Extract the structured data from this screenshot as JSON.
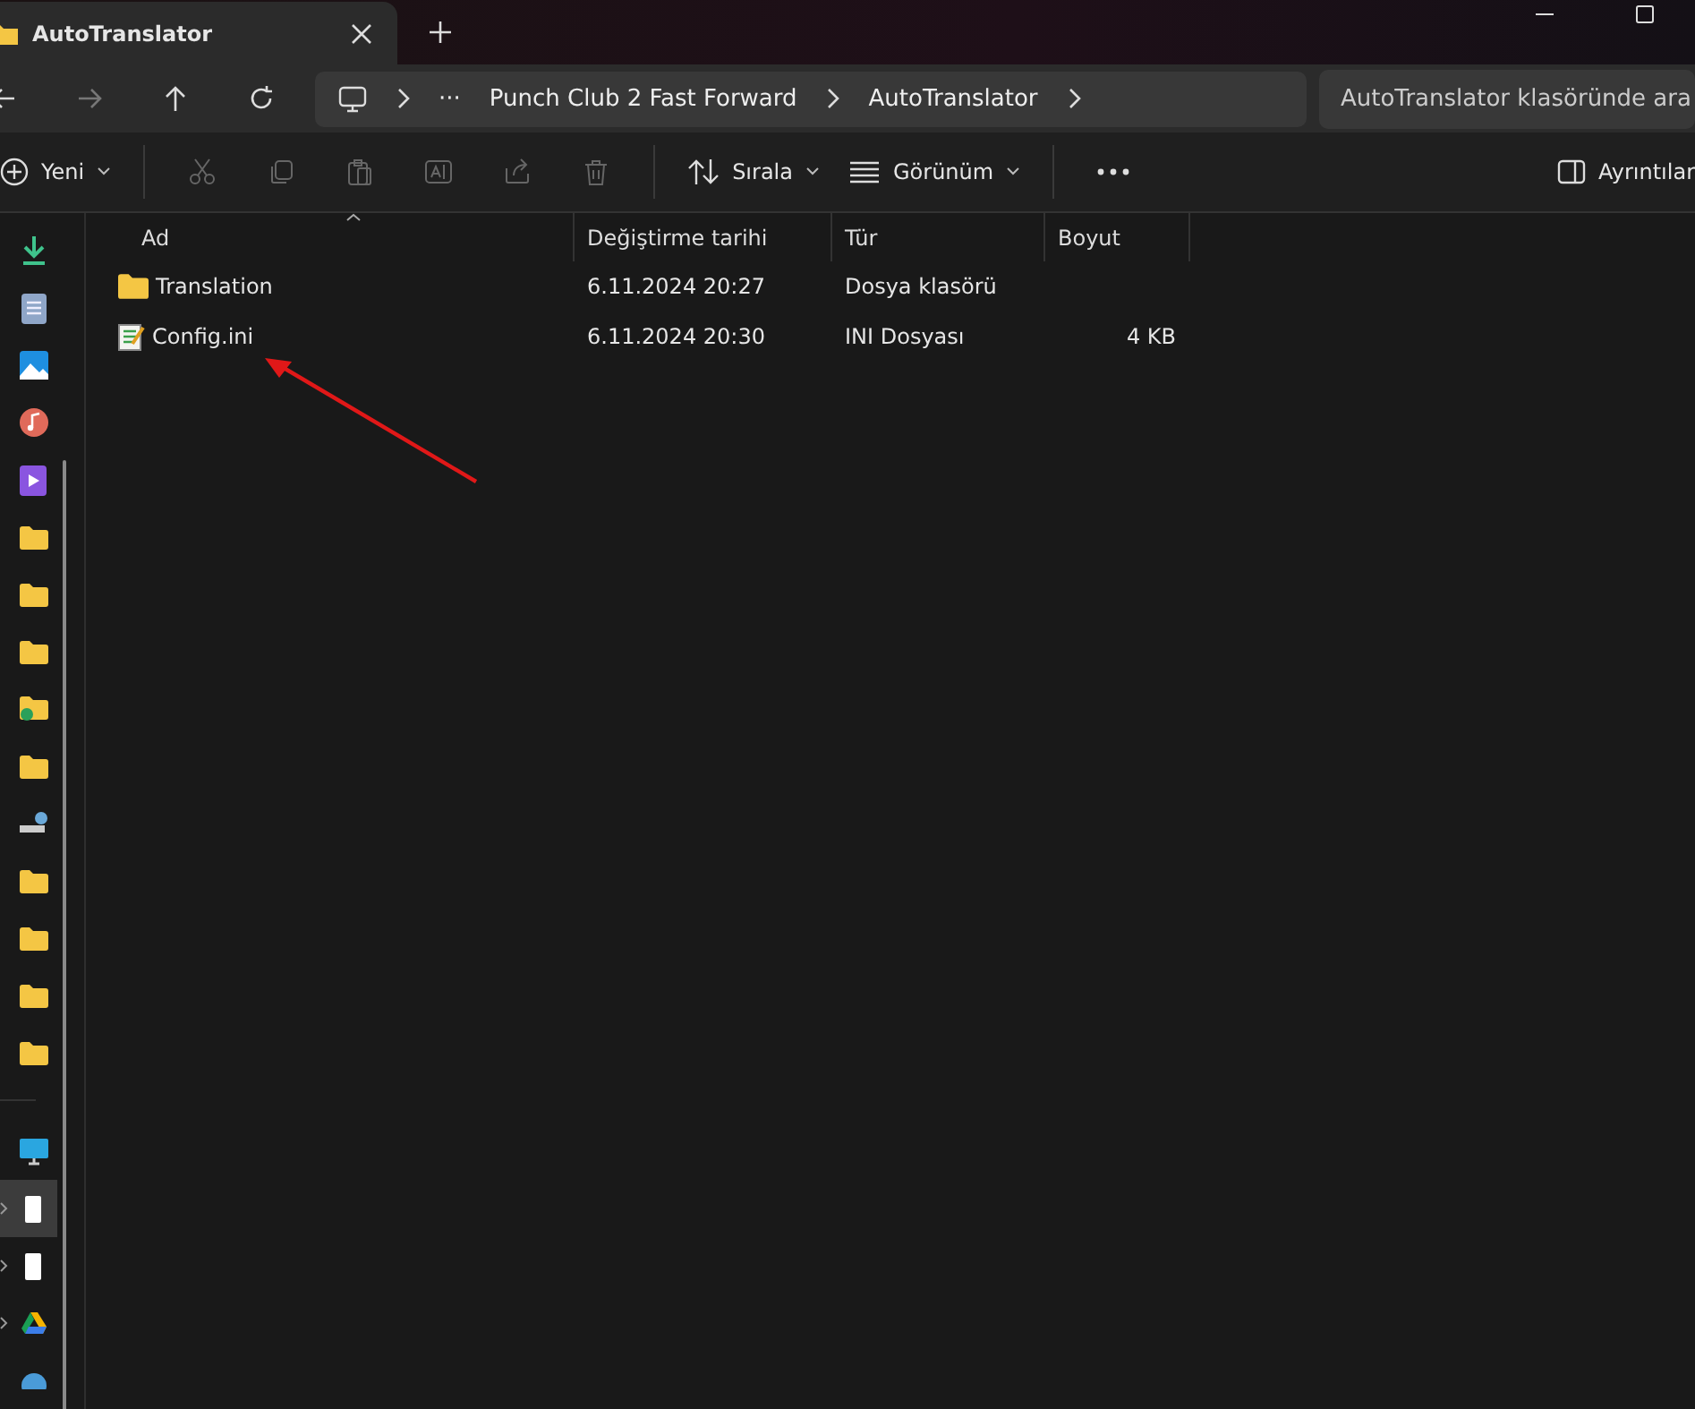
{
  "tab": {
    "title": "AutoTranslator"
  },
  "breadcrumb": {
    "ellipsis": "···",
    "segments": [
      "Punch Club 2 Fast Forward",
      "AutoTranslator"
    ]
  },
  "search": {
    "placeholder": "AutoTranslator klasöründe ara"
  },
  "toolbar": {
    "new": "Yeni",
    "sort": "Sırala",
    "view": "Görünüm",
    "details": "Ayrıntılar"
  },
  "sidebar": {
    "quick_access": [
      {
        "kind": "download",
        "selected": false,
        "expandable": false
      },
      {
        "kind": "document",
        "selected": false,
        "expandable": false
      },
      {
        "kind": "image",
        "selected": false,
        "expandable": false
      },
      {
        "kind": "music",
        "selected": false,
        "expandable": false
      },
      {
        "kind": "video",
        "selected": false,
        "expandable": false
      },
      {
        "kind": "folder",
        "selected": false,
        "expandable": false
      },
      {
        "kind": "folder",
        "selected": false,
        "expandable": false
      },
      {
        "kind": "folder",
        "selected": false,
        "expandable": false
      },
      {
        "kind": "folder-sync",
        "selected": false,
        "expandable": false
      },
      {
        "kind": "folder",
        "selected": false,
        "expandable": false
      },
      {
        "kind": "drive",
        "selected": false,
        "expandable": false
      },
      {
        "kind": "folder",
        "selected": false,
        "expandable": false
      },
      {
        "kind": "folder",
        "selected": false,
        "expandable": false
      },
      {
        "kind": "folder",
        "selected": false,
        "expandable": false
      },
      {
        "kind": "folder",
        "selected": false,
        "expandable": false
      }
    ],
    "devices": [
      {
        "kind": "computer",
        "selected": false,
        "expandable": false
      },
      {
        "kind": "page",
        "selected": true,
        "expandable": true
      },
      {
        "kind": "page",
        "selected": false,
        "expandable": true
      },
      {
        "kind": "cloud",
        "selected": false,
        "expandable": true
      },
      {
        "kind": "network",
        "selected": false,
        "expandable": false
      }
    ]
  },
  "table": {
    "columns": [
      "Ad",
      "Değiştirme tarihi",
      "Tür",
      "Boyut"
    ],
    "rows": [
      {
        "kind": "folder",
        "name": "Translation",
        "date": "6.11.2024 20:27",
        "type": "Dosya klasörü"
      },
      {
        "kind": "ini",
        "name": "Config.ini",
        "date": "6.11.2024 20:30",
        "type": "INI Dosyası",
        "size": "4 KB"
      }
    ]
  }
}
